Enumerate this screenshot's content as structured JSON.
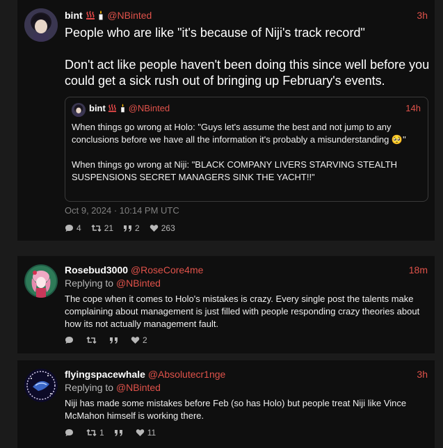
{
  "colors": {
    "accent": "#e0524a",
    "card_bg": "#0f0f0f",
    "page_bg": "#1b1b1b"
  },
  "main_tweet": {
    "name": "bint",
    "name_emojis": [
      "hot-springs-emoji",
      "candle-emoji"
    ],
    "handle": "@NBinted",
    "time": "3h",
    "text": "People who are like \"it's because of Niji's track record\"\n\nDon't act like people haven't been doing this since well before you could get a sick rush out of bringing up February's events.",
    "quote": {
      "name": "bint",
      "handle": "@NBinted",
      "time": "14h",
      "text_part1": "When things go wrong at Holo: \"Guys let's assume the best and not jump to any conclusions before we have all the information it's probably a misunderstanding ",
      "emoji": "🥺",
      "text_part2": "\"\n\nWhen things go wrong at Niji: \"BLACK COMPANY LIVERS STARVING STEALTH SUSPENSIONS SECRET MANAGERS SINK THE YACHT!!\""
    },
    "date": "Oct 9, 2024 · 10:14 PM UTC",
    "stats": {
      "comments": "4",
      "retweets": "21",
      "quotes": "2",
      "likes": "263"
    }
  },
  "replies": [
    {
      "name": "Rosebud3000",
      "handle": "@RoseCore4me",
      "time": "18m",
      "replying_label": "Replying to",
      "replying_handle": "@NBinted",
      "text": "The cope when it comes to Holo's mistakes is crazy. Every single post the talents make complaining about management is just filled with people responding crazy theories about how its not actually management fault.",
      "stats": {
        "comments": "",
        "retweets": "",
        "quotes": "",
        "likes": "2"
      }
    },
    {
      "name": "flyingspacewhale",
      "handle": "@Absolutecr1nge",
      "time": "3h",
      "replying_label": "Replying to",
      "replying_handle": "@NBinted",
      "text": "Niji has made some mistakes before Feb (so has Holo) but people treat Niji like Vince McMahon himself is working there.",
      "stats": {
        "comments": "",
        "retweets": "1",
        "quotes": "",
        "likes": "11"
      }
    }
  ]
}
